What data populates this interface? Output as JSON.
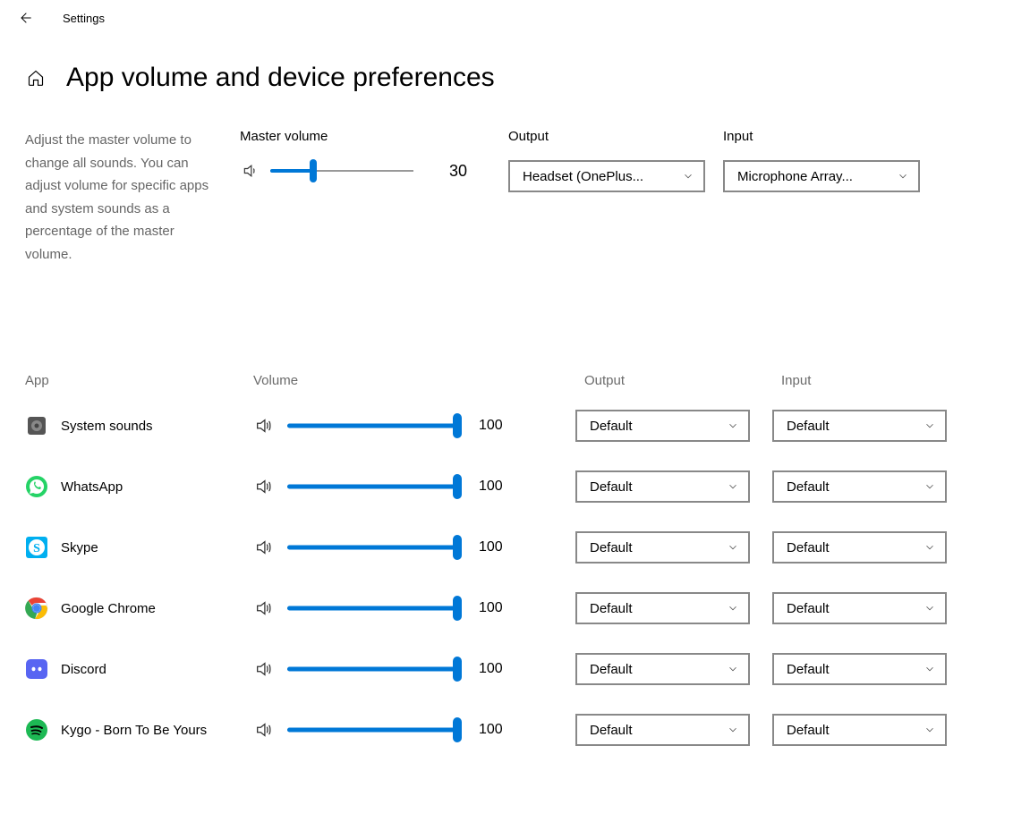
{
  "topbar": {
    "app_title": "Settings"
  },
  "header": {
    "page_title": "App volume and device preferences"
  },
  "master": {
    "description": "Adjust the master volume to change all sounds. You can adjust volume for specific apps and system sounds as a percentage of the master volume.",
    "volume_label": "Master volume",
    "volume_value": 30,
    "output_label": "Output",
    "output_selected": "Headset (OnePlus...",
    "input_label": "Input",
    "input_selected": "Microphone Array..."
  },
  "columns": {
    "app": "App",
    "volume": "Volume",
    "output": "Output",
    "input": "Input"
  },
  "apps": [
    {
      "name": "System sounds",
      "icon": "system",
      "volume": 100,
      "output": "Default",
      "input": "Default"
    },
    {
      "name": "WhatsApp",
      "icon": "whatsapp",
      "volume": 100,
      "output": "Default",
      "input": "Default"
    },
    {
      "name": "Skype",
      "icon": "skype",
      "volume": 100,
      "output": "Default",
      "input": "Default"
    },
    {
      "name": "Google Chrome",
      "icon": "chrome",
      "volume": 100,
      "output": "Default",
      "input": "Default"
    },
    {
      "name": "Discord",
      "icon": "discord",
      "volume": 100,
      "output": "Default",
      "input": "Default"
    },
    {
      "name": "Kygo - Born To Be Yours",
      "icon": "spotify",
      "volume": 100,
      "output": "Default",
      "input": "Default"
    }
  ]
}
